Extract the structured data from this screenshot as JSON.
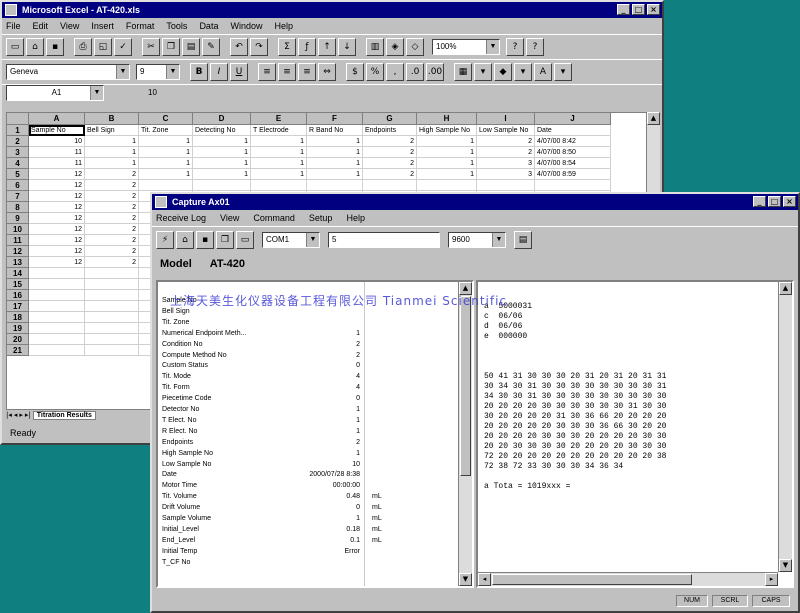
{
  "colors": {
    "desktop": "#0f7f7f",
    "titlebar": "#000080",
    "watermark": "#3b3bd4"
  },
  "excel": {
    "title": "Microsoft Excel - AT-420.xls",
    "menu": [
      "File",
      "Edit",
      "View",
      "Insert",
      "Format",
      "Tools",
      "Data",
      "Window",
      "Help"
    ],
    "zoom": "100%",
    "font_name": "Geneva",
    "font_size": "9",
    "name_box": "A1",
    "formula_value": "10",
    "columns": [
      "A",
      "B",
      "C",
      "D",
      "E",
      "F",
      "G",
      "H",
      "I",
      "J"
    ],
    "headers": [
      "Sample No",
      "Bell Sign",
      "Tit. Zone",
      "Detecting No",
      "T Electrode",
      "R Band No",
      "Endpoints",
      "High Sample No",
      "Low Sample No",
      "Date"
    ],
    "rows": [
      [
        "10",
        "1",
        "1",
        "1",
        "1",
        "1",
        "2",
        "1",
        "2",
        "4/07/00 8:42"
      ],
      [
        "11",
        "1",
        "1",
        "1",
        "1",
        "1",
        "2",
        "1",
        "2",
        "4/07/00 8:50"
      ],
      [
        "11",
        "1",
        "1",
        "1",
        "1",
        "1",
        "2",
        "1",
        "3",
        "4/07/00 8:54"
      ],
      [
        "12",
        "2",
        "1",
        "1",
        "1",
        "1",
        "2",
        "1",
        "3",
        "4/07/00 8:59"
      ],
      [
        "12",
        "2",
        "",
        "",
        "",
        "",
        "",
        "",
        "",
        ""
      ],
      [
        "12",
        "2",
        "",
        "",
        "",
        "",
        "",
        "",
        "",
        ""
      ],
      [
        "12",
        "2",
        "",
        "",
        "",
        "",
        "",
        "",
        "",
        ""
      ],
      [
        "12",
        "2",
        "",
        "",
        "",
        "",
        "",
        "",
        "",
        ""
      ],
      [
        "12",
        "2",
        "",
        "",
        "",
        "",
        "",
        "",
        "",
        ""
      ],
      [
        "12",
        "2",
        "",
        "",
        "",
        "",
        "",
        "",
        "",
        ""
      ],
      [
        "12",
        "2",
        "",
        "",
        "",
        "",
        "",
        "",
        "",
        ""
      ],
      [
        "12",
        "2",
        "",
        "",
        "",
        "",
        "",
        "",
        "",
        ""
      ],
      [
        "",
        "",
        "",
        "",
        "",
        "",
        "",
        "",
        "",
        ""
      ],
      [
        "",
        "",
        "",
        "",
        "",
        "",
        "",
        "",
        "",
        ""
      ],
      [
        "",
        "",
        "",
        "",
        "",
        "",
        "",
        "",
        "",
        ""
      ],
      [
        "",
        "",
        "",
        "",
        "",
        "",
        "",
        "",
        "",
        ""
      ],
      [
        "",
        "",
        "",
        "",
        "",
        "",
        "",
        "",
        "",
        ""
      ],
      [
        "",
        "",
        "",
        "",
        "",
        "",
        "",
        "",
        "",
        ""
      ],
      [
        "",
        "",
        "",
        "",
        "",
        "",
        "",
        "",
        "",
        ""
      ],
      [
        "",
        "",
        "",
        "",
        "",
        "",
        "",
        "",
        "",
        ""
      ]
    ],
    "row_numbers": [
      "1",
      "2",
      "3",
      "4",
      "5",
      "6",
      "7",
      "8",
      "9",
      "10",
      "11",
      "12",
      "13",
      "14",
      "15",
      "16",
      "17",
      "18",
      "19",
      "20",
      "21"
    ],
    "sheet_tab": "Titration Results",
    "status": "Ready"
  },
  "capture": {
    "title": "Capture Ax01",
    "menu": [
      "Receive Log",
      "View",
      "Command",
      "Setup",
      "Help"
    ],
    "port": "COM1",
    "field": "5",
    "baud": "9600",
    "model_label": "Model",
    "model_value": "AT-420",
    "watermark": "上海天美生化仪器设备工程有限公司 Tianmei Scientific",
    "fields": [
      {
        "name": "Sample No",
        "value": "",
        "unit": ""
      },
      {
        "name": "Bell Sign",
        "value": "",
        "unit": ""
      },
      {
        "name": "Tit. Zone",
        "value": "",
        "unit": ""
      },
      {
        "name": "Numerical Endpoint Meth...",
        "value": "1",
        "unit": ""
      },
      {
        "name": "Condition No",
        "value": "2",
        "unit": ""
      },
      {
        "name": "Compute Method No",
        "value": "2",
        "unit": ""
      },
      {
        "name": "Custom Status",
        "value": "0",
        "unit": ""
      },
      {
        "name": "Tit. Mode",
        "value": "4",
        "unit": ""
      },
      {
        "name": "Tit. Form",
        "value": "4",
        "unit": ""
      },
      {
        "name": "Piecetime Code",
        "value": "0",
        "unit": ""
      },
      {
        "name": "Detector No",
        "value": "1",
        "unit": ""
      },
      {
        "name": "T Elect. No",
        "value": "1",
        "unit": ""
      },
      {
        "name": "R Elect. No",
        "value": "1",
        "unit": ""
      },
      {
        "name": "Endpoints",
        "value": "2",
        "unit": ""
      },
      {
        "name": "High Sample No",
        "value": "1",
        "unit": ""
      },
      {
        "name": "Low Sample No",
        "value": "10",
        "unit": ""
      },
      {
        "name": "Date",
        "value": "2000/07/28 8:38",
        "unit": ""
      },
      {
        "name": "Motor Time",
        "value": "00:00:00",
        "unit": ""
      },
      {
        "name": "Tit. Volume",
        "value": "0.48",
        "unit": "mL"
      },
      {
        "name": "Drift Volume",
        "value": "0",
        "unit": "mL"
      },
      {
        "name": "Sample Volume",
        "value": "1",
        "unit": "mL"
      },
      {
        "name": "Initial_Level",
        "value": "0.18",
        "unit": "mL"
      },
      {
        "name": "End_Level",
        "value": "0.1",
        "unit": "mL"
      },
      {
        "name": "Initial Temp",
        "value": "Error",
        "unit": ""
      },
      {
        "name": "T_CF No",
        "value": "",
        "unit": ""
      }
    ],
    "raw_lines": [
      "a  5000031",
      "c  06/06",
      "d  06/06",
      "e  000000",
      "",
      "",
      "",
      "50 41 31 30 30 30 20 31 20 31 20 31 31",
      "30 34 30 31 30 30 30 30 30 30 30 30 31",
      "34 30 30 31 30 30 30 30 30 30 30 30 30",
      "20 20 20 20 30 30 30 30 30 30 31 30 30",
      "30 20 20 20 20 31 30 36 66 20 20 20 20",
      "20 20 20 20 20 30 30 30 36 66 30 20 20",
      "20 20 20 20 30 30 30 20 20 20 20 30 30",
      "20 20 30 30 30 30 20 20 20 20 30 30 30",
      "72 20 20 20 20 20 20 20 20 20 20 20 38",
      "72 38 72 33 30 30 30 34 36 34",
      "",
      "a Tota = 1019xxx =",
      ""
    ],
    "status": [
      "NUM",
      "SCRL",
      "CAPS"
    ]
  }
}
